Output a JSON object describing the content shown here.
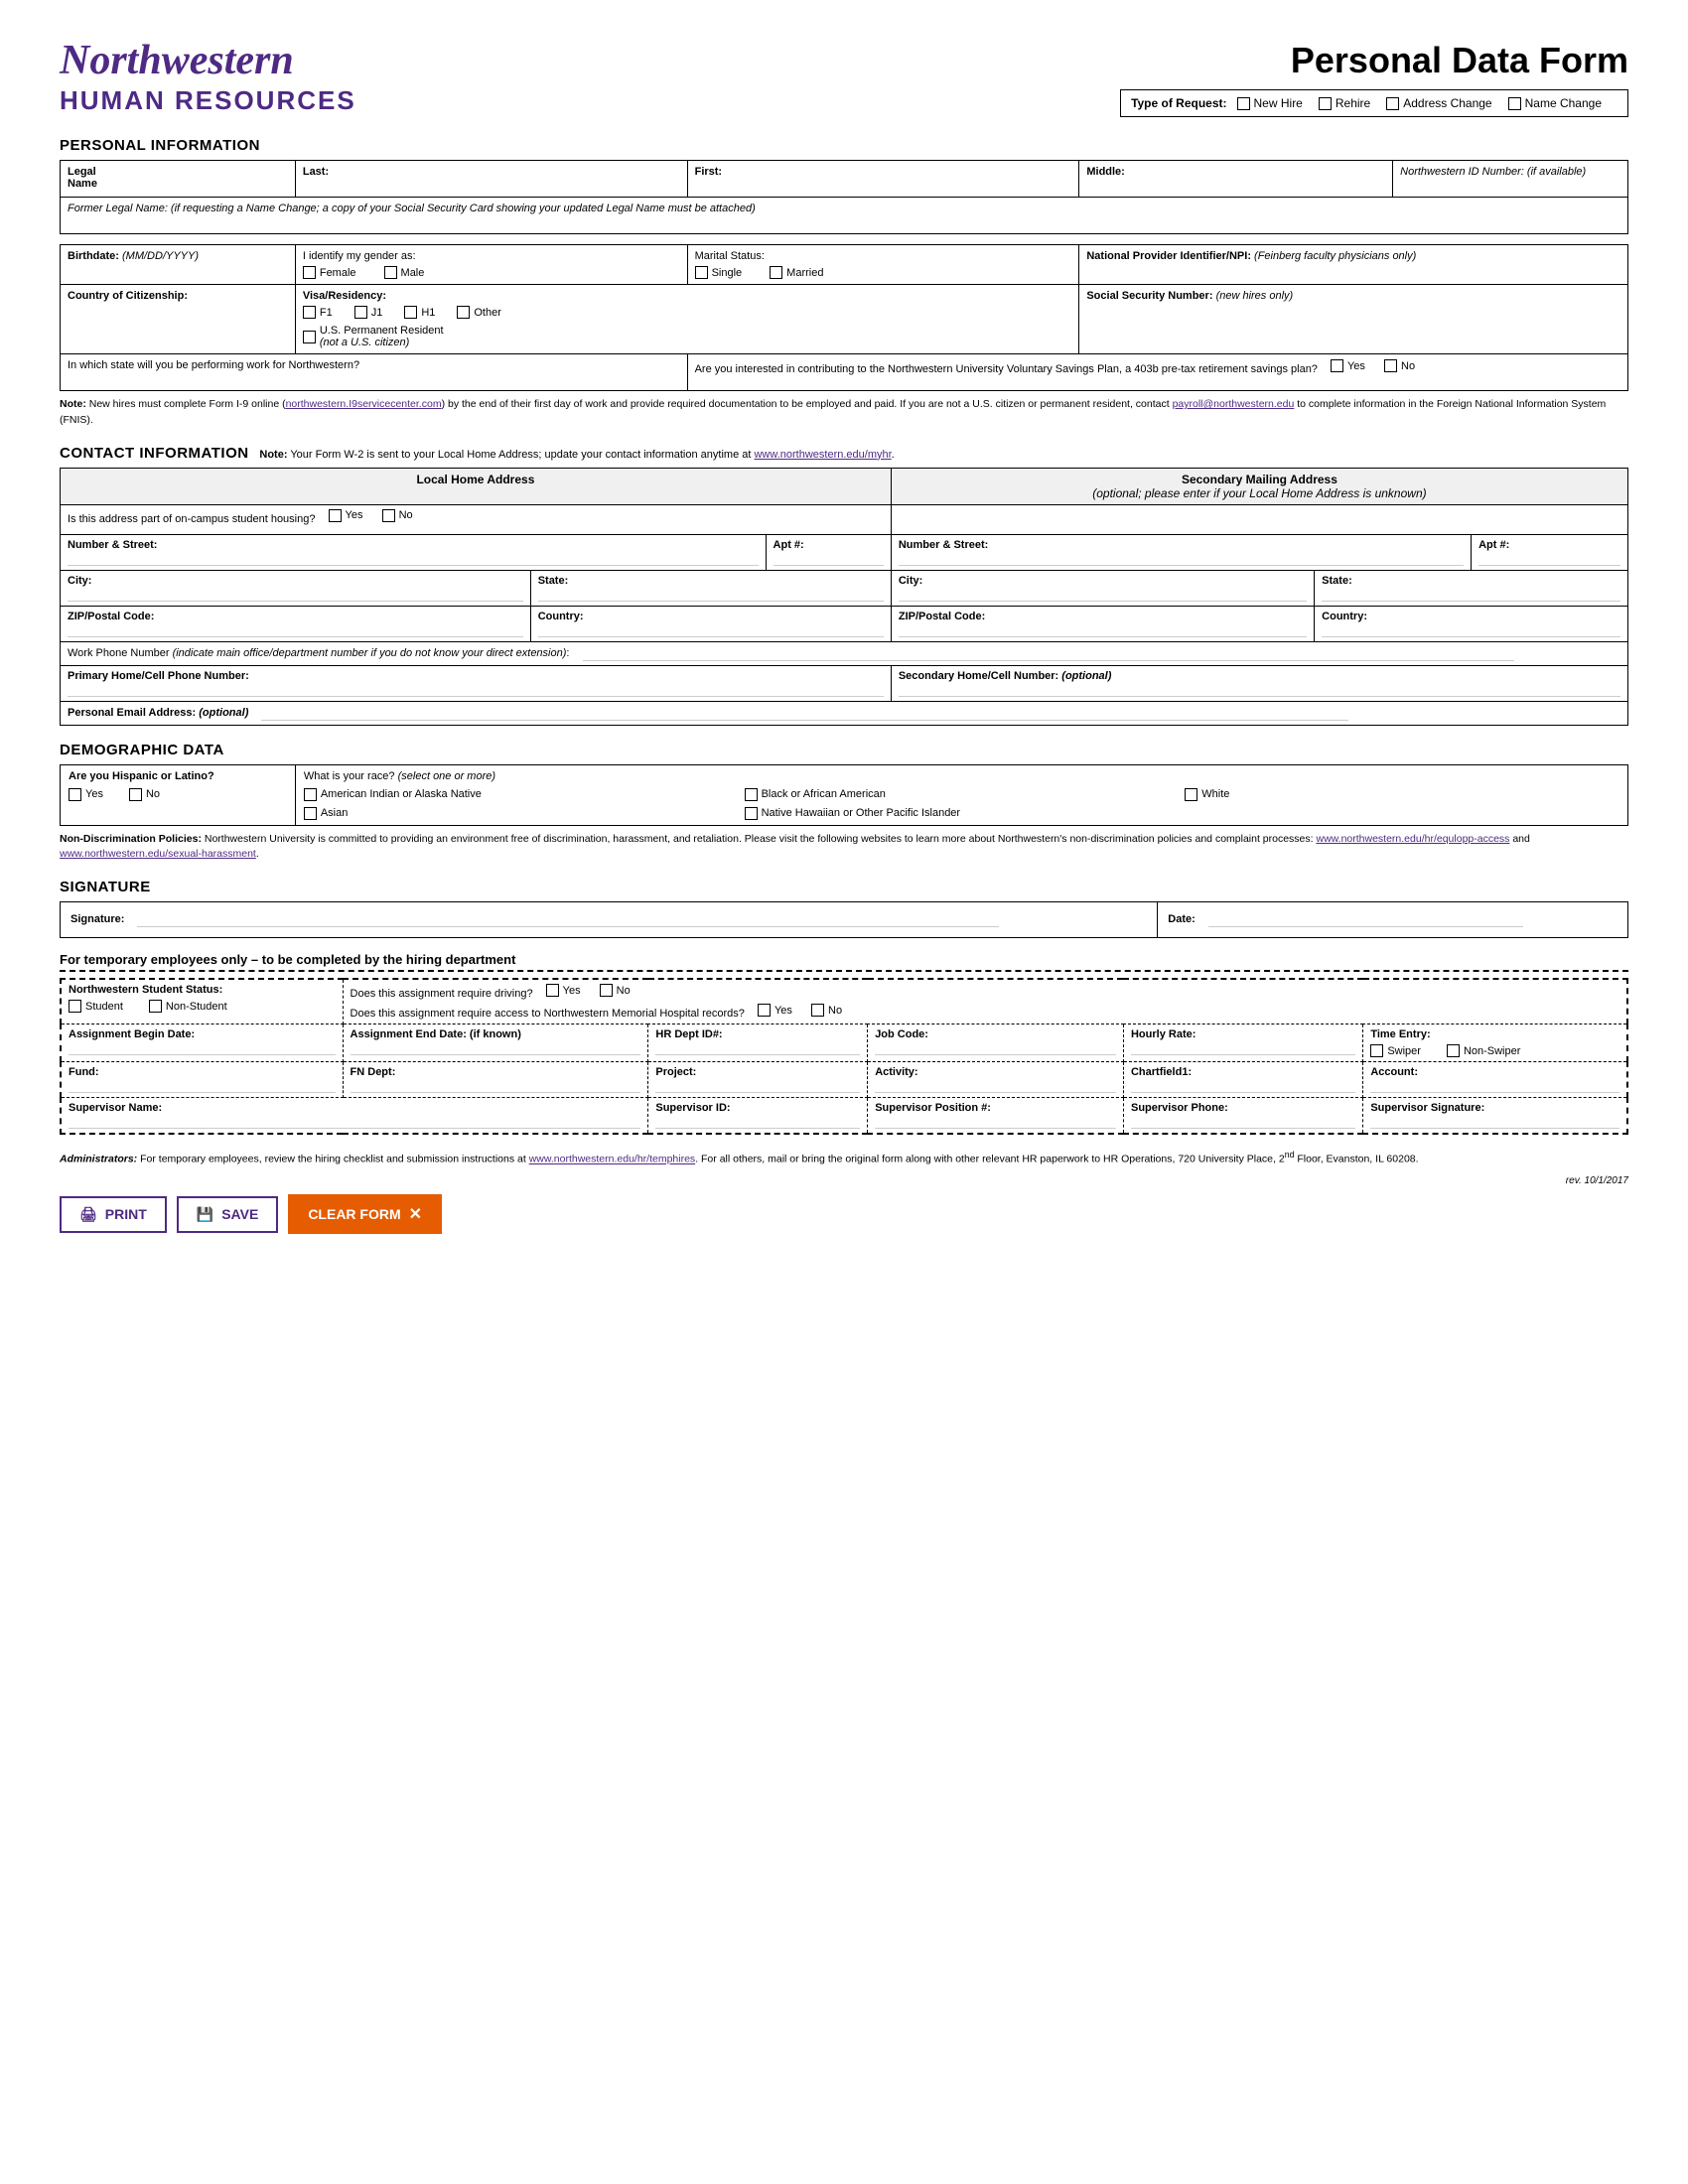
{
  "header": {
    "logo_name": "Northwestern",
    "logo_hr": "HUMAN RESOURCES",
    "form_title": "Personal Data Form",
    "type_of_request_label": "Type of Request:",
    "request_types": [
      "New Hire",
      "Rehire",
      "Address Change",
      "Name Change"
    ]
  },
  "personal_info": {
    "section_heading": "Personal Information",
    "legal_name_label": "Legal Name",
    "last_label": "Last:",
    "first_label": "First:",
    "middle_label": "Middle:",
    "nuid_label": "Northwestern ID Number: (if available)",
    "former_legal_label": "Former Legal Name: (if requesting a Name Change; a copy of your Social Security Card showing your updated Legal Name must be attached)",
    "birthdate_label": "Birthdate: (MM/DD/YYYY)",
    "gender_label": "I identify my gender as:",
    "female_label": "Female",
    "male_label": "Male",
    "marital_label": "Marital Status:",
    "single_label": "Single",
    "married_label": "Married",
    "npi_label": "National Provider Identifier/NPI: (Feinberg faculty physicians only)",
    "citizenship_label": "Country of Citizenship:",
    "visa_label": "Visa/Residency:",
    "visa_options": [
      "F1",
      "J1",
      "H1",
      "Other"
    ],
    "perm_resident_label": "U.S. Permanent Resident (not a U.S. citizen)",
    "ssn_label": "Social Security Number: (new hires only)",
    "work_state_label": "In which state will you be performing work for Northwestern?",
    "savings_label": "Are you interested in contributing to the Northwestern University Voluntary Savings Plan, a 403b pre-tax retirement savings plan?",
    "savings_yes": "Yes",
    "savings_no": "No",
    "note": "Note: New hires must complete Form I-9 online (northwestern.I9servicecenter.com) by the end of their first day of work and provide required documentation to be employed and paid. If you are not a U.S. citizen or permanent resident, contact payroll@northwestern.edu to complete information in the Foreign National Information System (FNIS)."
  },
  "contact_info": {
    "section_heading": "Contact Information",
    "note": "Note: Your Form W-2 is sent to your Local Home Address; update your contact information anytime at www.northwestern.edu/myhr.",
    "local_header": "Local Home Address",
    "student_housing_label": "Is this address part of on-campus student housing?",
    "yes_label": "Yes",
    "no_label": "No",
    "secondary_header": "Secondary Mailing Address",
    "secondary_note": "(optional; please enter if your Local Home Address is unknown)",
    "number_street_label": "Number & Street:",
    "apt_label": "Apt #:",
    "city_label": "City:",
    "state_label": "State:",
    "zip_label": "ZIP/Postal Code:",
    "country_label": "Country:",
    "work_phone_label": "Work Phone Number (indicate main office/department number if you do not know your direct extension):",
    "primary_phone_label": "Primary Home/Cell Phone Number:",
    "secondary_phone_label": "Secondary Home/Cell Number: (optional)",
    "email_label": "Personal Email Address: (optional)"
  },
  "demographic": {
    "section_heading": "Demographic Data",
    "hispanic_label": "Are you Hispanic or Latino?",
    "yes_label": "Yes",
    "no_label": "No",
    "race_label": "What is your race? (select one or more)",
    "race_options": [
      "American Indian or Alaska Native",
      "Asian",
      "Black or African American",
      "Native Hawaiian or Other Pacific Islander",
      "White"
    ],
    "non_disc_heading": "Non-Discrimination Policies:",
    "non_disc_text": " Northwestern University is committed to providing an environment free of discrimination, harassment, and retaliation. Please visit the following websites to learn more about Northwestern's non-discrimination policies and complaint processes: www.northwestern.edu/hr/equlopp-access and www.northwestern.edu/sexual-harassment."
  },
  "signature": {
    "section_heading": "Signature",
    "signature_label": "Signature:",
    "date_label": "Date:"
  },
  "temp_employees": {
    "section_heading": "For temporary employees only – to be completed by the hiring department",
    "student_status_label": "Northwestern Student Status:",
    "student_label": "Student",
    "non_student_label": "Non-Student",
    "driving_label": "Does this assignment require driving?",
    "yes_label": "Yes",
    "no_label": "No",
    "hospital_label": "Does this assignment require access to Northwestern Memorial Hospital records?",
    "yes2_label": "Yes",
    "no2_label": "No",
    "begin_date_label": "Assignment Begin Date:",
    "end_date_label": "Assignment End Date: (if known)",
    "hr_dept_label": "HR Dept ID#:",
    "job_code_label": "Job Code:",
    "hourly_label": "Hourly Rate:",
    "time_entry_label": "Time Entry:",
    "swiper_label": "Swiper",
    "non_swiper_label": "Non-Swiper",
    "fund_label": "Fund:",
    "fn_dept_label": "FN Dept:",
    "project_label": "Project:",
    "activity_label": "Activity:",
    "chartfield_label": "Chartfield1:",
    "account_label": "Account:",
    "supervisor_name_label": "Supervisor Name:",
    "supervisor_id_label": "Supervisor ID:",
    "supervisor_pos_label": "Supervisor Position #:",
    "supervisor_phone_label": "Supervisor Phone:",
    "supervisor_sig_label": "Supervisor Signature:"
  },
  "footer": {
    "admin_note": "Administrators: For temporary employees, review the hiring checklist and submission instructions at www.northwestern.edu/hr/temphires. For all others, mail or bring the original form along with other relevant HR paperwork to HR Operations, 720 University Place, 2nd Floor, Evanston, IL 60208.",
    "rev_date": "rev. 10/1/2017",
    "print_label": "PRINT",
    "save_label": "SAVE",
    "clear_label": "CLEAR FORM"
  }
}
